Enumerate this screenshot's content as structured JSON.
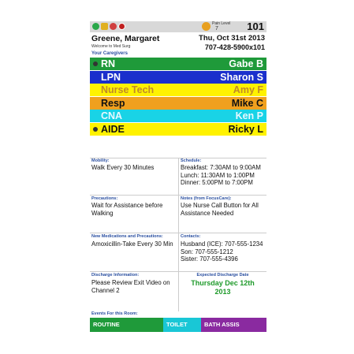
{
  "header": {
    "pain_label": "Pain Level",
    "pain_value": "7",
    "room": "101",
    "patient_name": "Greene, Margaret",
    "welcome": "Welcome to Med Surg",
    "date": "Thu, Oct 31st 2013",
    "phone": "707-428-5900x101",
    "icons": [
      "green-status-icon",
      "hazard-icon",
      "fall-risk-icon",
      "no-entry-icon"
    ]
  },
  "caregivers": {
    "title": "Your Caregivers",
    "rows": [
      {
        "role": "RN",
        "name": "Gabe B",
        "bg": "#1f9a3a",
        "fg": "#ffffff"
      },
      {
        "role": "LPN",
        "name": "Sharon S",
        "bg": "#1a2fcc",
        "fg": "#ffffff"
      },
      {
        "role": "Nurse Tech",
        "name": "Amy F",
        "bg": "#fff200",
        "fg": "#c08a2a"
      },
      {
        "role": "Resp",
        "name": "Mike C",
        "bg": "#f0a01e",
        "fg": "#111111"
      },
      {
        "role": "CNA",
        "name": "Ken P",
        "bg": "#19d3e6",
        "fg": "#e8f8ff"
      },
      {
        "role": "AIDE",
        "name": "Ricky L",
        "bg": "#fff200",
        "fg": "#111111"
      }
    ]
  },
  "info": {
    "mobility_label": "Mobility:",
    "mobility_text": "Walk Every 30 Minutes",
    "schedule_label": "Schedule:",
    "schedule_text": "Breakfast: 7:30AM to 9:00AM\nLunch: 11:30AM to 1:00PM\nDinner: 5:00PM to 7:00PM",
    "precautions_label": "Precautions:",
    "precautions_text": "Wait for Assistance before\nWalking",
    "notes_label": "Notes (from FocusCare):",
    "notes_text": "Use Nurse Call Button for All\nAssistance Needed",
    "meds_label": "New Medications and Precautions:",
    "meds_text": "Amoxicillin-Take Every 30 Min",
    "contacts_label": "Contacts:",
    "contacts_text": "Husband (ICE): 707-555-1234\nSon: 707-555-1212\nSister: 707-555-4396",
    "discharge_info_label": "Discharge Information:",
    "discharge_info_text": "Please Review Exit Video on\nChannel 2",
    "discharge_date_label": "Expected Discharge Date",
    "discharge_date": "Thursday Dec 12th\n2013"
  },
  "events": {
    "title": "Events For this Room:",
    "buttons": [
      {
        "label": "ROUTINE",
        "color": "#1f9a3a"
      },
      {
        "label": "TOILET",
        "color": "#19c7d6"
      },
      {
        "label": "BATH ASSIS",
        "color": "#8a2aa0"
      }
    ]
  }
}
